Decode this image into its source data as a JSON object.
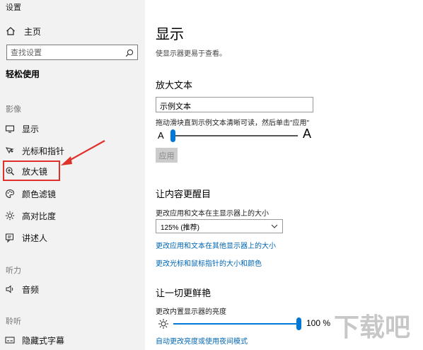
{
  "window": {
    "title": "设置"
  },
  "sidebar": {
    "home_label": "主页",
    "search_placeholder": "查找设置",
    "section_title": "轻松使用",
    "groups": {
      "vision": "影像",
      "hearing": "听力",
      "interaction": "聆听"
    },
    "items": [
      {
        "label": "显示",
        "icon": "monitor-icon"
      },
      {
        "label": "光标和指针",
        "icon": "cursor-icon"
      },
      {
        "label": "放大镜",
        "icon": "magnifier-icon"
      },
      {
        "label": "颜色滤镜",
        "icon": "palette-icon"
      },
      {
        "label": "高对比度",
        "icon": "contrast-icon"
      },
      {
        "label": "讲述人",
        "icon": "narrator-icon"
      },
      {
        "label": "音频",
        "icon": "speaker-icon"
      },
      {
        "label": "隐藏式字幕",
        "icon": "captions-icon"
      }
    ],
    "annotation_color": "#e0302a"
  },
  "main": {
    "title": "显示",
    "description": "使显示器更易于查看。",
    "text_size": {
      "heading": "放大文本",
      "sample_value": "示例文本",
      "instruction": "拖动滑块直到示例文本清晰可读，然后单击\"应用\"",
      "small_a": "A",
      "big_a": "A",
      "slider_value": 0.0,
      "apply_label": "应用"
    },
    "make_bigger": {
      "heading": "让内容更醒目",
      "scale_label": "更改应用和文本在主显示器上的大小",
      "scale_selected": "125% (推荐)",
      "link1": "更改应用和文本在其他显示器上的大小",
      "link2": "更改光标和鼠标指针的大小和颜色"
    },
    "brightness": {
      "heading": "让一切更鲜艳",
      "label": "更改内置显示器的亮度",
      "value_text": "100 %",
      "value": 1.0,
      "link": "自动更改亮度或使用夜间模式"
    }
  },
  "accent_color": "#0078d7",
  "watermark_text": "下载吧"
}
